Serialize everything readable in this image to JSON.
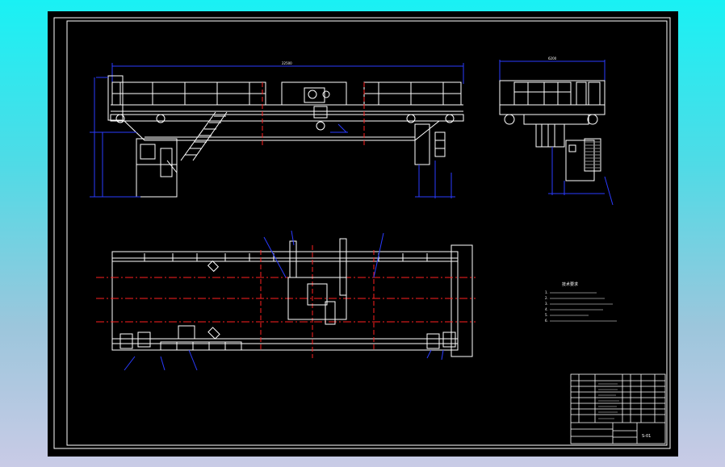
{
  "drawing": {
    "colors": {
      "background": "#000000",
      "outline": "#ffffff",
      "centerline": "#ff2020",
      "dimension": "#2a3bff",
      "hatch": "#ffffff"
    },
    "dimension_labels": {
      "front_span": "22500",
      "side_width": "6200"
    },
    "notes": {
      "heading": "技术要求",
      "items": [
        "1.",
        "2.",
        "3.",
        "4.",
        "5.",
        "6."
      ]
    },
    "title_block": {
      "drawing_number": "S-01"
    }
  }
}
